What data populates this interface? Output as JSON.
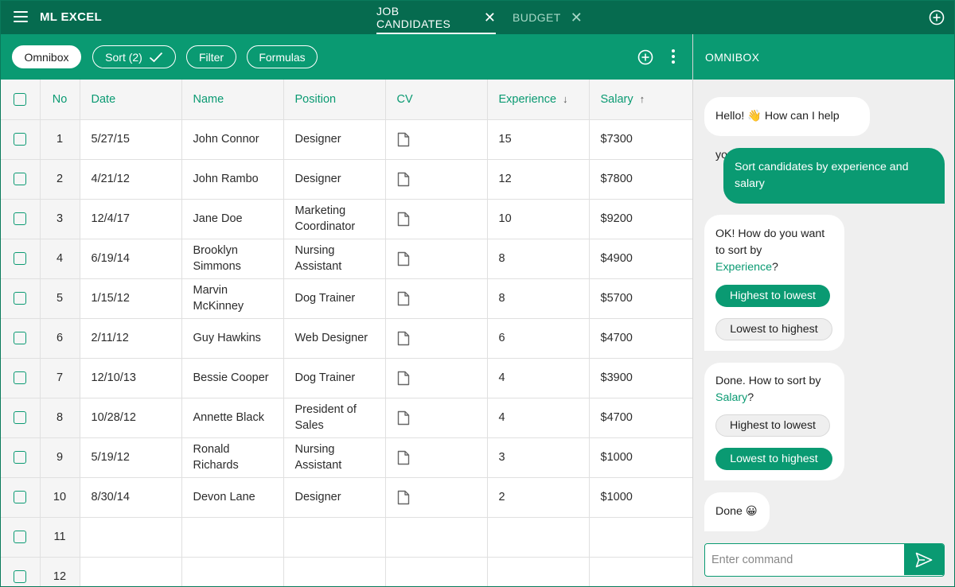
{
  "app": {
    "title": "ML EXCEL"
  },
  "tabs": [
    {
      "label": "JOB CANDIDATES",
      "active": true
    },
    {
      "label": "BUDGET",
      "active": false
    }
  ],
  "toolbar": {
    "omnibox_label": "Omnibox",
    "sort_label": "Sort (2)",
    "filter_label": "Filter",
    "formulas_label": "Formulas"
  },
  "omnibox": {
    "title": "OMNIBOX"
  },
  "table": {
    "columns": [
      "No",
      "Date",
      "Name",
      "Position",
      "CV",
      "Experience",
      "Salary"
    ],
    "sort": {
      "Experience": "desc",
      "Salary": "asc"
    },
    "rows": [
      {
        "no": "1",
        "date": "5/27/15",
        "name": "John Connor",
        "position": "Designer",
        "experience": "15",
        "salary": "$7300"
      },
      {
        "no": "2",
        "date": "4/21/12",
        "name": "John Rambo",
        "position": "Designer",
        "experience": "12",
        "salary": "$7800"
      },
      {
        "no": "3",
        "date": "12/4/17",
        "name": "Jane Doe",
        "position": "Marketing Coordinator",
        "experience": "10",
        "salary": "$9200"
      },
      {
        "no": "4",
        "date": "6/19/14",
        "name": "Brooklyn Simmons",
        "position": "Nursing Assistant",
        "experience": "8",
        "salary": "$4900"
      },
      {
        "no": "5",
        "date": "1/15/12",
        "name": "Marvin McKinney",
        "position": "Dog Trainer",
        "experience": "8",
        "salary": "$5700"
      },
      {
        "no": "6",
        "date": "2/11/12",
        "name": "Guy Hawkins",
        "position": "Web Designer",
        "experience": "6",
        "salary": "$4700"
      },
      {
        "no": "7",
        "date": "12/10/13",
        "name": "Bessie Cooper",
        "position": "Dog Trainer",
        "experience": "4",
        "salary": "$3900"
      },
      {
        "no": "8",
        "date": "10/28/12",
        "name": "Annette Black",
        "position": "President of Sales",
        "experience": "4",
        "salary": "$4700"
      },
      {
        "no": "9",
        "date": "5/19/12",
        "name": "Ronald Richards",
        "position": "Nursing Assistant",
        "experience": "3",
        "salary": "$1000"
      },
      {
        "no": "10",
        "date": "8/30/14",
        "name": "Devon Lane",
        "position": "Designer",
        "experience": "2",
        "salary": "$1000"
      }
    ],
    "empty_rows": [
      "11",
      "12"
    ]
  },
  "chat": {
    "greeting": "Hello! 👋 How can I help you?",
    "user_message": "Sort candidates by experience and salary",
    "q1_prefix": "OK! How do you want to sort by",
    "q1_field": "Experience",
    "q1_suffix": "?",
    "q1_options": [
      "Highest to lowest",
      "Lowest to highest"
    ],
    "q1_selected": "Highest to lowest",
    "q2_prefix": "Done. How to sort by",
    "q2_field": "Salary",
    "q2_suffix": "?",
    "q2_options": [
      "Highest to lowest",
      "Lowest to highest"
    ],
    "q2_selected": "Lowest to highest",
    "done": "Done 😀",
    "input_placeholder": "Enter command"
  },
  "colors": {
    "header_dark": "#066b4f",
    "accent": "#0a9a72",
    "panel_bg": "#efefef"
  },
  "icons": [
    "menu-icon",
    "close-icon",
    "add-circle-icon",
    "check-icon",
    "more-vertical-icon",
    "document-icon",
    "arrow-down-icon",
    "arrow-up-icon",
    "send-icon"
  ]
}
